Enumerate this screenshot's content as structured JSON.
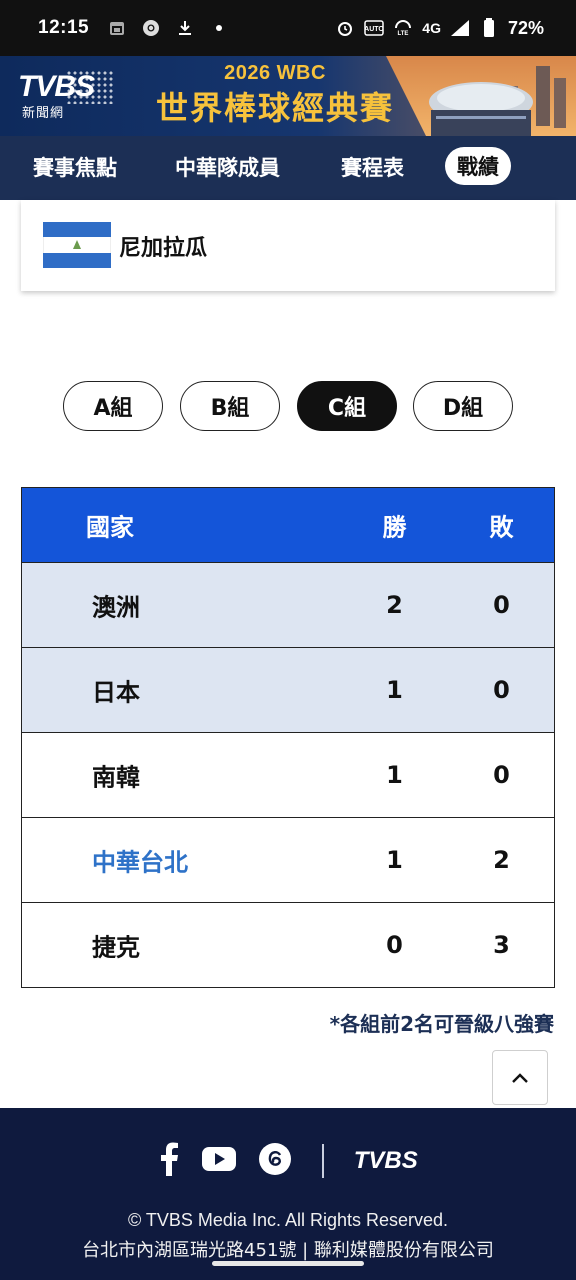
{
  "status_bar": {
    "time": "12:15",
    "battery": "72%",
    "network": "4G"
  },
  "banner": {
    "logo_text": "TVBS",
    "logo_sub": "新聞網",
    "line1": "2026 WBC",
    "line2": "世界棒球經典賽"
  },
  "nav": {
    "tabs": [
      {
        "label": "賽事焦點",
        "active": false
      },
      {
        "label": "中華隊成員",
        "active": false
      },
      {
        "label": "賽程表",
        "active": false
      },
      {
        "label": "戰績",
        "active": true
      }
    ]
  },
  "team_card": {
    "name": "尼加拉瓜"
  },
  "groups": [
    {
      "label": "A組",
      "active": false
    },
    {
      "label": "B組",
      "active": false
    },
    {
      "label": "C組",
      "active": true
    },
    {
      "label": "D組",
      "active": false
    }
  ],
  "standings": {
    "headers": {
      "country": "國家",
      "wins": "勝",
      "losses": "敗"
    },
    "rows": [
      {
        "country": "澳洲",
        "wins": "2",
        "losses": "0"
      },
      {
        "country": "日本",
        "wins": "1",
        "losses": "0"
      },
      {
        "country": "南韓",
        "wins": "1",
        "losses": "0"
      },
      {
        "country": "中華台北",
        "wins": "1",
        "losses": "2"
      },
      {
        "country": "捷克",
        "wins": "0",
        "losses": "3"
      }
    ]
  },
  "note": "*各組前2名可晉級八強賽",
  "footer": {
    "logo_text": "TVBS",
    "copyright": "© TVBS Media Inc. All Rights Reserved.",
    "address": "台北市內湖區瑞光路451號 | 聯利媒體股份有限公司"
  },
  "colors": {
    "nav_bg": "#1c2f55",
    "table_header": "#1455d9",
    "highlight_row": "#dde5f2",
    "favorite_team": "#2e72c8",
    "footer_bg": "#0f1a3e",
    "banner_gold": "#f7c23c"
  }
}
